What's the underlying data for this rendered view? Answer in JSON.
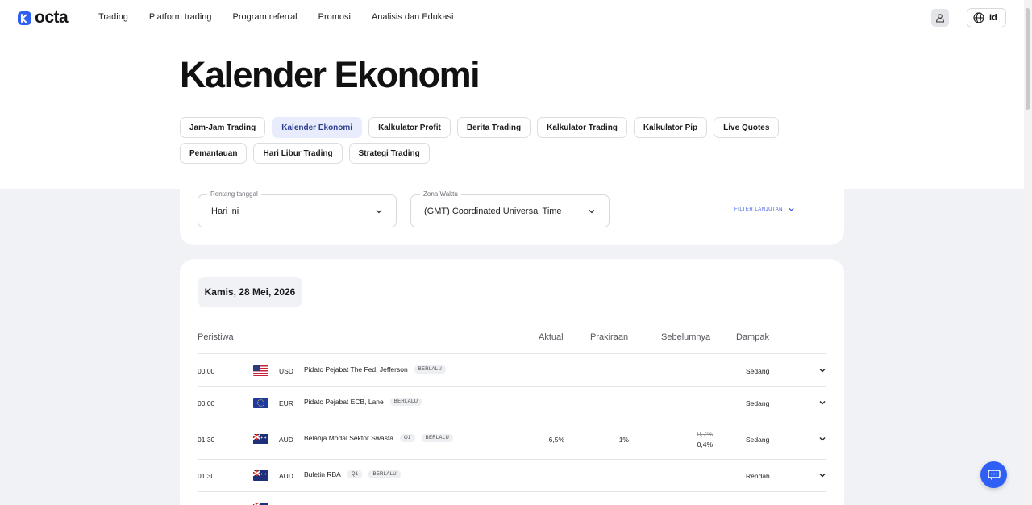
{
  "brand": {
    "name": "octa",
    "accent": "#2f5ff5"
  },
  "nav": {
    "items": [
      "Trading",
      "Platform trading",
      "Program referral",
      "Promosi",
      "Analisis dan Edukasi"
    ],
    "language": "Id"
  },
  "page": {
    "title": "Kalender Ekonomi",
    "tabs": [
      "Jam-Jam Trading",
      "Kalender Ekonomi",
      "Kalkulator Profit",
      "Berita Trading",
      "Kalkulator Trading",
      "Kalkulator Pip",
      "Live Quotes",
      "Pemantauan",
      "Hari Libur Trading",
      "Strategi Trading"
    ],
    "active_tab": "Kalender Ekonomi"
  },
  "filters": {
    "date_range": {
      "label": "Rentang tanggal",
      "value": "Hari ini"
    },
    "timezone": {
      "label": "Zona Waktu",
      "value": "(GMT) Coordinated Universal Time"
    },
    "advanced_label": "FILTER LANJUTAN"
  },
  "calendar": {
    "date": "Kamis, 28 Mei, 2026",
    "columns": {
      "event": "Peristiwa",
      "actual": "Aktual",
      "forecast": "Prakiraan",
      "previous": "Sebelumnya",
      "impact": "Dampak"
    },
    "rows": [
      {
        "time": "00:00",
        "flag": "us-flag-icon",
        "currency": "USD",
        "event": "Pidato Pejabat The Fed, Jefferson",
        "period": "",
        "status": "BERLALU",
        "actual": "",
        "forecast": "",
        "previous": "",
        "previous_revised": "",
        "impact": "Sedang"
      },
      {
        "time": "00:00",
        "flag": "eu-flag-icon",
        "currency": "EUR",
        "event": "Pidato Pejabat ECB, Lane",
        "period": "",
        "status": "BERLALU",
        "actual": "",
        "forecast": "",
        "previous": "",
        "previous_revised": "",
        "impact": "Sedang"
      },
      {
        "time": "01:30",
        "flag": "au-flag-icon",
        "currency": "AUD",
        "event": "Belanja Modal Sektor Swasta",
        "period": "Q1",
        "status": "BERLALU",
        "actual": "6,5%",
        "forecast": "1%",
        "previous": "0,7%",
        "previous_revised": "0,4%",
        "impact": "Sedang"
      },
      {
        "time": "01:30",
        "flag": "au-flag-icon",
        "currency": "AUD",
        "event": "Buletin RBA",
        "period": "Q1",
        "status": "BERLALU",
        "actual": "",
        "forecast": "",
        "previous": "",
        "previous_revised": "",
        "impact": "Rendah"
      }
    ]
  }
}
